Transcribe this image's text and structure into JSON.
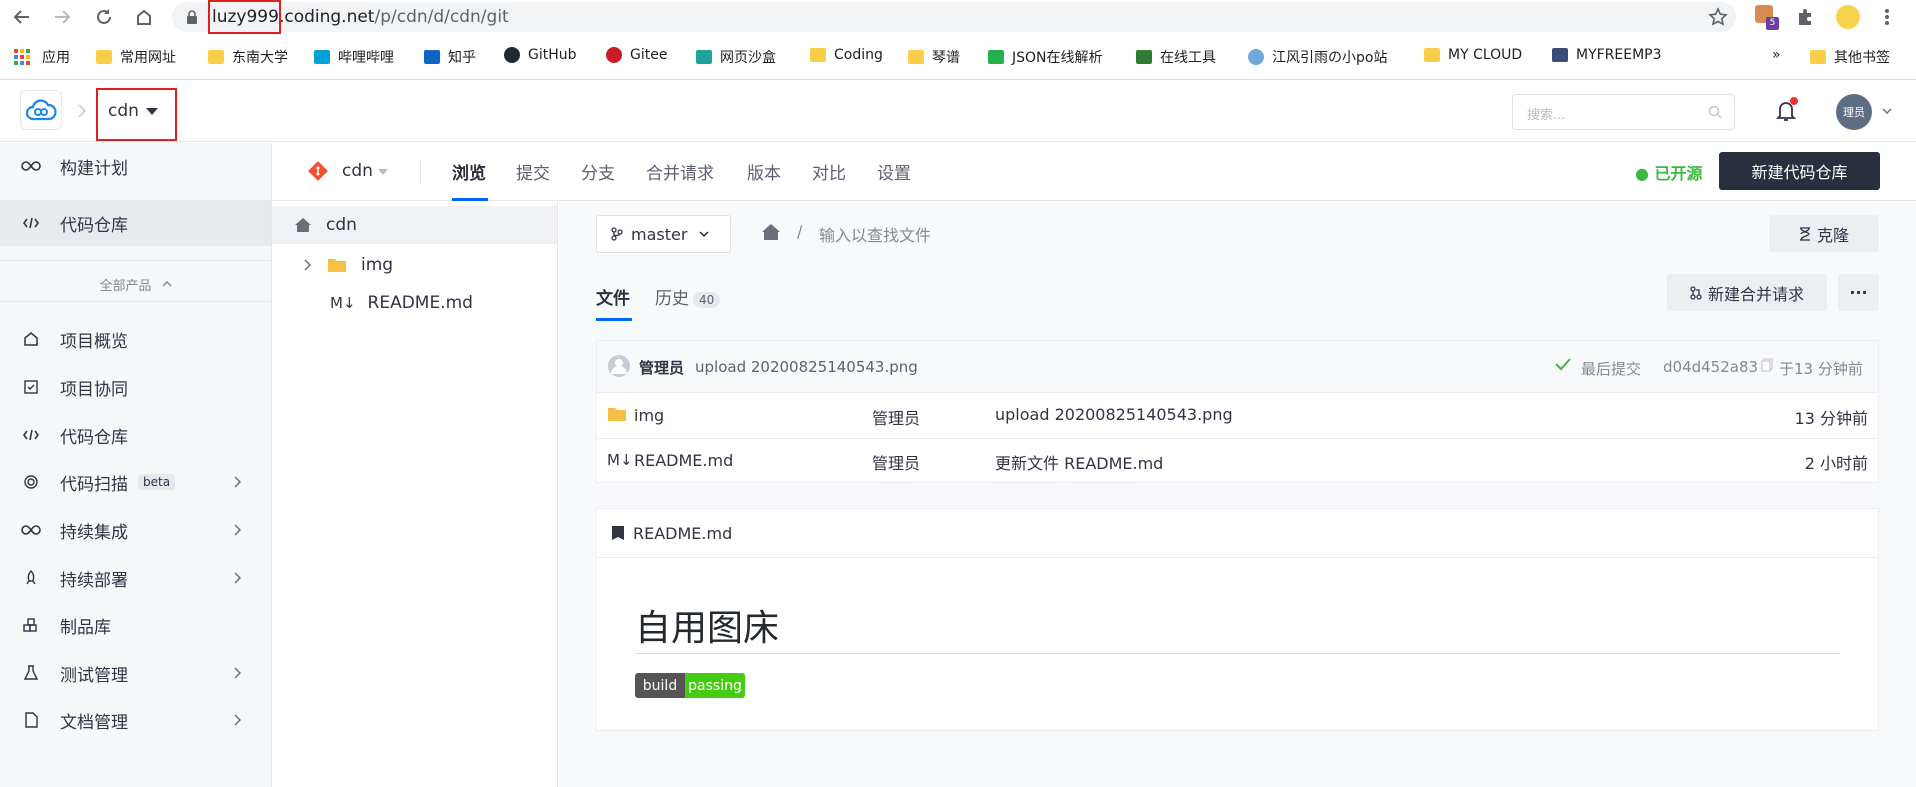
{
  "browser": {
    "url_host_highlight": "luzy999",
    "url_rest": ".coding.net",
    "url_path": "/p/cdn/d/cdn/git",
    "extension_badge": "5",
    "bookmarks": [
      {
        "label": "应用"
      },
      {
        "label": "常用网址"
      },
      {
        "label": "东南大学"
      },
      {
        "label": "哔哩哔哩"
      },
      {
        "label": "知乎"
      },
      {
        "label": "GitHub"
      },
      {
        "label": "Gitee"
      },
      {
        "label": "网页沙盒"
      },
      {
        "label": "Coding"
      },
      {
        "label": "琴谱"
      },
      {
        "label": "JSON在线解析"
      },
      {
        "label": "在线工具"
      },
      {
        "label": "江风引雨の小po站"
      },
      {
        "label": "MY CLOUD"
      },
      {
        "label": "MYFREEMP3"
      },
      {
        "label": "»"
      },
      {
        "label": "其他书签"
      }
    ]
  },
  "header": {
    "project_name": "cdn",
    "search_placeholder": "搜索...",
    "avatar_text": "理员"
  },
  "sidebar": {
    "top_items": [
      {
        "label": "构建计划",
        "icon": "infinity-icon"
      },
      {
        "label": "代码仓库",
        "icon": "code-icon"
      }
    ],
    "all_products_label": "全部产品",
    "items": [
      {
        "label": "项目概览",
        "icon": "home-icon"
      },
      {
        "label": "项目协同",
        "icon": "checkbox-icon"
      },
      {
        "label": "代码仓库",
        "icon": "code-icon"
      },
      {
        "label": "代码扫描",
        "icon": "scan-icon",
        "badge": "beta"
      },
      {
        "label": "持续集成",
        "icon": "infinity-icon"
      },
      {
        "label": "持续部署",
        "icon": "rocket-icon"
      },
      {
        "label": "制品库",
        "icon": "package-icon"
      },
      {
        "label": "测试管理",
        "icon": "flask-icon"
      },
      {
        "label": "文档管理",
        "icon": "document-icon"
      }
    ]
  },
  "repo_nav": {
    "repo_name": "cdn",
    "tabs": [
      "浏览",
      "提交",
      "分支",
      "合并请求",
      "版本",
      "对比",
      "设置"
    ],
    "open_source_label": "● 已开源",
    "new_repo_label": "新建代码仓库"
  },
  "tree": {
    "root": "cdn",
    "items": [
      {
        "name": "img",
        "type": "folder"
      },
      {
        "name": "README.md",
        "type": "markdown"
      }
    ]
  },
  "main": {
    "branch": "master",
    "path_placeholder": "输入以查找文件",
    "clone_label": "克隆",
    "file_tab": "文件",
    "history_tab": "历史",
    "history_count": "40",
    "new_mr_label": "新建合并请求",
    "more_label": "···",
    "last_commit": {
      "author": "管理员",
      "message": "upload 20200825140543.png",
      "status": "最后提交",
      "hash": "d04d452a83",
      "time": "于13 分钟前"
    },
    "files": [
      {
        "name": "img",
        "type": "folder",
        "author": "管理员",
        "message": "upload 20200825140543.png",
        "time": "13 分钟前"
      },
      {
        "name": "README.md",
        "type": "markdown",
        "author": "管理员",
        "message": "更新文件 README.md",
        "time": "2 小时前"
      }
    ],
    "readme": {
      "filename": "README.md",
      "heading": "自用图床",
      "badge_left": "build",
      "badge_right": "passing"
    }
  }
}
